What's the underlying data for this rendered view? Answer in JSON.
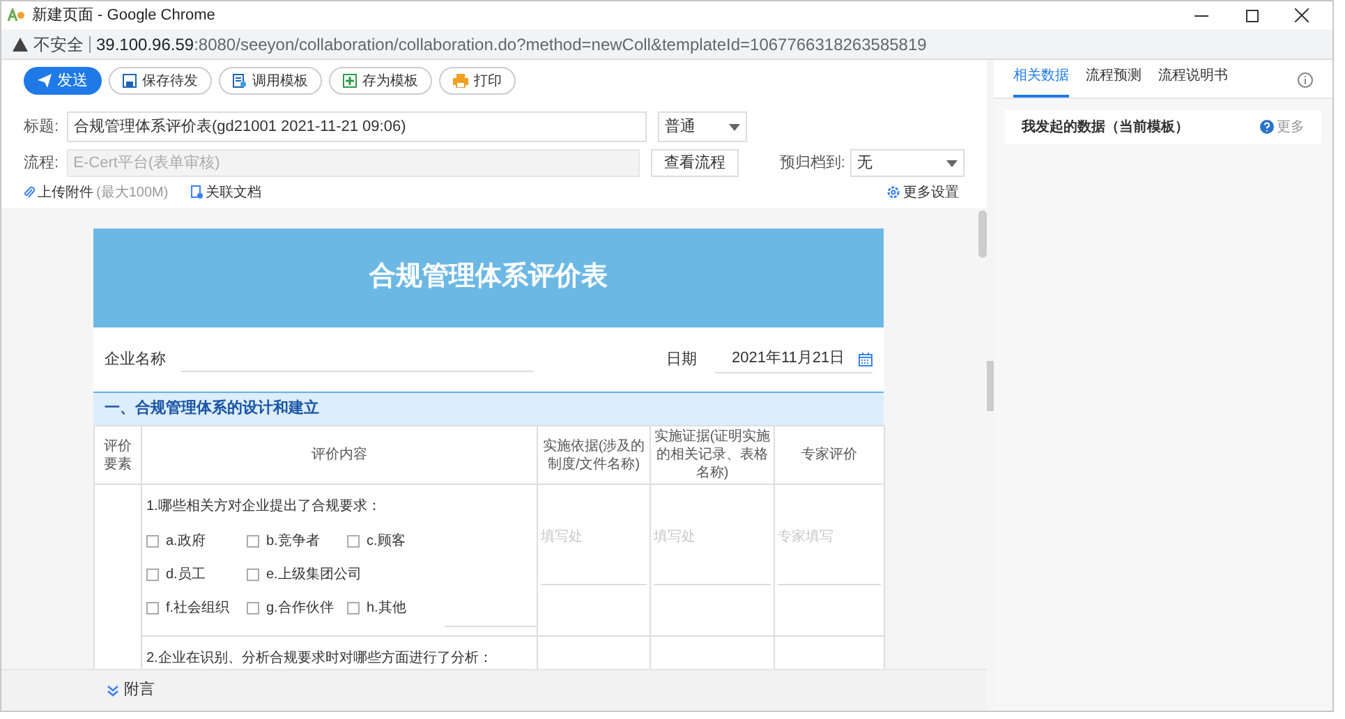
{
  "window": {
    "title": "新建页面 - Google Chrome",
    "insecure_label": "不安全",
    "url_host": "39.100.96.59",
    "url_path": ":8080/seeyon/collaboration/collaboration.do?method=newColl&templateId=1067766318263585819"
  },
  "toolbar": [
    {
      "kind": "send",
      "label": "发送"
    },
    {
      "kind": "save",
      "label": "保存待发"
    },
    {
      "kind": "load_template",
      "label": "调用模板"
    },
    {
      "kind": "save_template",
      "label": "存为模板"
    },
    {
      "kind": "print",
      "label": "打印"
    }
  ],
  "subject": {
    "label": "标题:",
    "value": "合规管理体系评价表(gd21001 2021-11-21 09:06)",
    "priority": "普通"
  },
  "flow": {
    "label": "流程:",
    "value": "E-Cert平台(表单审核)",
    "disabled": true,
    "button": "查看流程",
    "archive_label": "预归档到:",
    "archive_value": "无"
  },
  "attach": {
    "upload": "上传附件",
    "limit": "(最大100M)",
    "related": "关联文档",
    "more_settings": "更多设置"
  },
  "form": {
    "title": "合规管理体系评价表",
    "company_label": "企业名称",
    "date_label": "日期",
    "date_value": "2021年11月21日",
    "section": "一、合规管理体系的设计和建立",
    "columns": [
      "评价要素",
      "评价内容",
      "实施依据(涉及的制度/文件名称)",
      "实施证据(证明实施的相关记录、表格名称)",
      "专家评价"
    ],
    "questions": [
      {
        "text": "1.哪些相关方对企业提出了合规要求：",
        "options": [
          {
            "label": "a.政府",
            "checked": false
          },
          {
            "label": "b.竞争者",
            "checked": false
          },
          {
            "label": "c.顾客",
            "checked": false
          },
          {
            "label": "d.员工",
            "checked": false
          },
          {
            "label": "e.上级集团公司",
            "checked": false
          },
          {
            "label": "f.社会组织",
            "checked": false
          },
          {
            "label": "g.合作伙伴",
            "checked": false
          },
          {
            "label": "h.其他",
            "checked": false
          }
        ],
        "placeholders": [
          "填写处",
          "填写处",
          "专家填写"
        ]
      },
      {
        "text": "2.企业在识别、分析合规要求时对哪些方面进行了分析："
      }
    ]
  },
  "footer": {
    "label": "附言"
  },
  "panel": {
    "tabs": [
      {
        "label": "相关数据",
        "selected": true
      },
      {
        "label": "流程预测",
        "selected": false
      },
      {
        "label": "流程说明书",
        "selected": false
      }
    ],
    "card_title": "我发起的数据（当前模板）",
    "more": "更多"
  }
}
